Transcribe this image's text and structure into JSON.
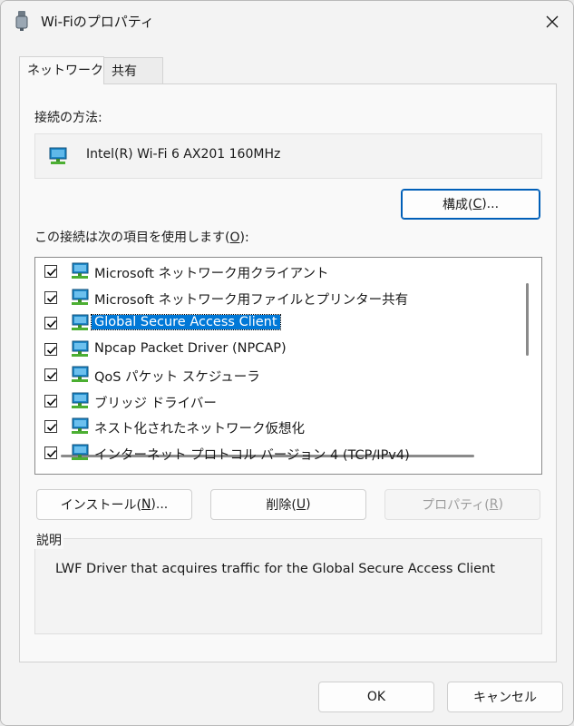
{
  "window": {
    "title": "Wi-Fiのプロパティ"
  },
  "tabs": [
    {
      "label": "ネットワーク"
    },
    {
      "label": "共有"
    }
  ],
  "connect_using": {
    "label": "接続の方法:",
    "adapter": "Intel(R) Wi-Fi 6 AX201 160MHz",
    "configure_button": {
      "text": "構成(",
      "key": "C",
      "suffix": ")..."
    }
  },
  "items_section": {
    "label_pre": "この接続は次の項目を使用します(",
    "label_key": "O",
    "label_post": "):",
    "items": [
      {
        "label": "Microsoft ネットワーク用クライアント",
        "checked": true
      },
      {
        "label": "Microsoft ネットワーク用ファイルとプリンター共有",
        "checked": true
      },
      {
        "label": "Global Secure Access Client",
        "checked": true,
        "selected": true
      },
      {
        "label": "Npcap Packet Driver (NPCAP)",
        "checked": true
      },
      {
        "label": "QoS パケット スケジューラ",
        "checked": true
      },
      {
        "label": "ブリッジ ドライバー",
        "checked": true
      },
      {
        "label": "ネスト化されたネットワーク仮想化",
        "checked": true
      },
      {
        "label": "インターネット プロトコル バージョン 4 (TCP/IPv4)",
        "checked": true
      }
    ]
  },
  "buttons": {
    "install": {
      "text": "インストール(",
      "key": "N",
      "suffix": ")..."
    },
    "uninstall": {
      "text": "削除(",
      "key": "U",
      "suffix": ")"
    },
    "properties": {
      "text": "プロパティ(",
      "key": "R",
      "suffix": ")"
    }
  },
  "description": {
    "title": "説明",
    "text": "LWF Driver that acquires traffic for the Global Secure Access Client"
  },
  "footer": {
    "ok": "OK",
    "cancel": "キャンセル"
  },
  "colors": {
    "selection": "#0078d7",
    "accent_border": "#005fb8"
  }
}
